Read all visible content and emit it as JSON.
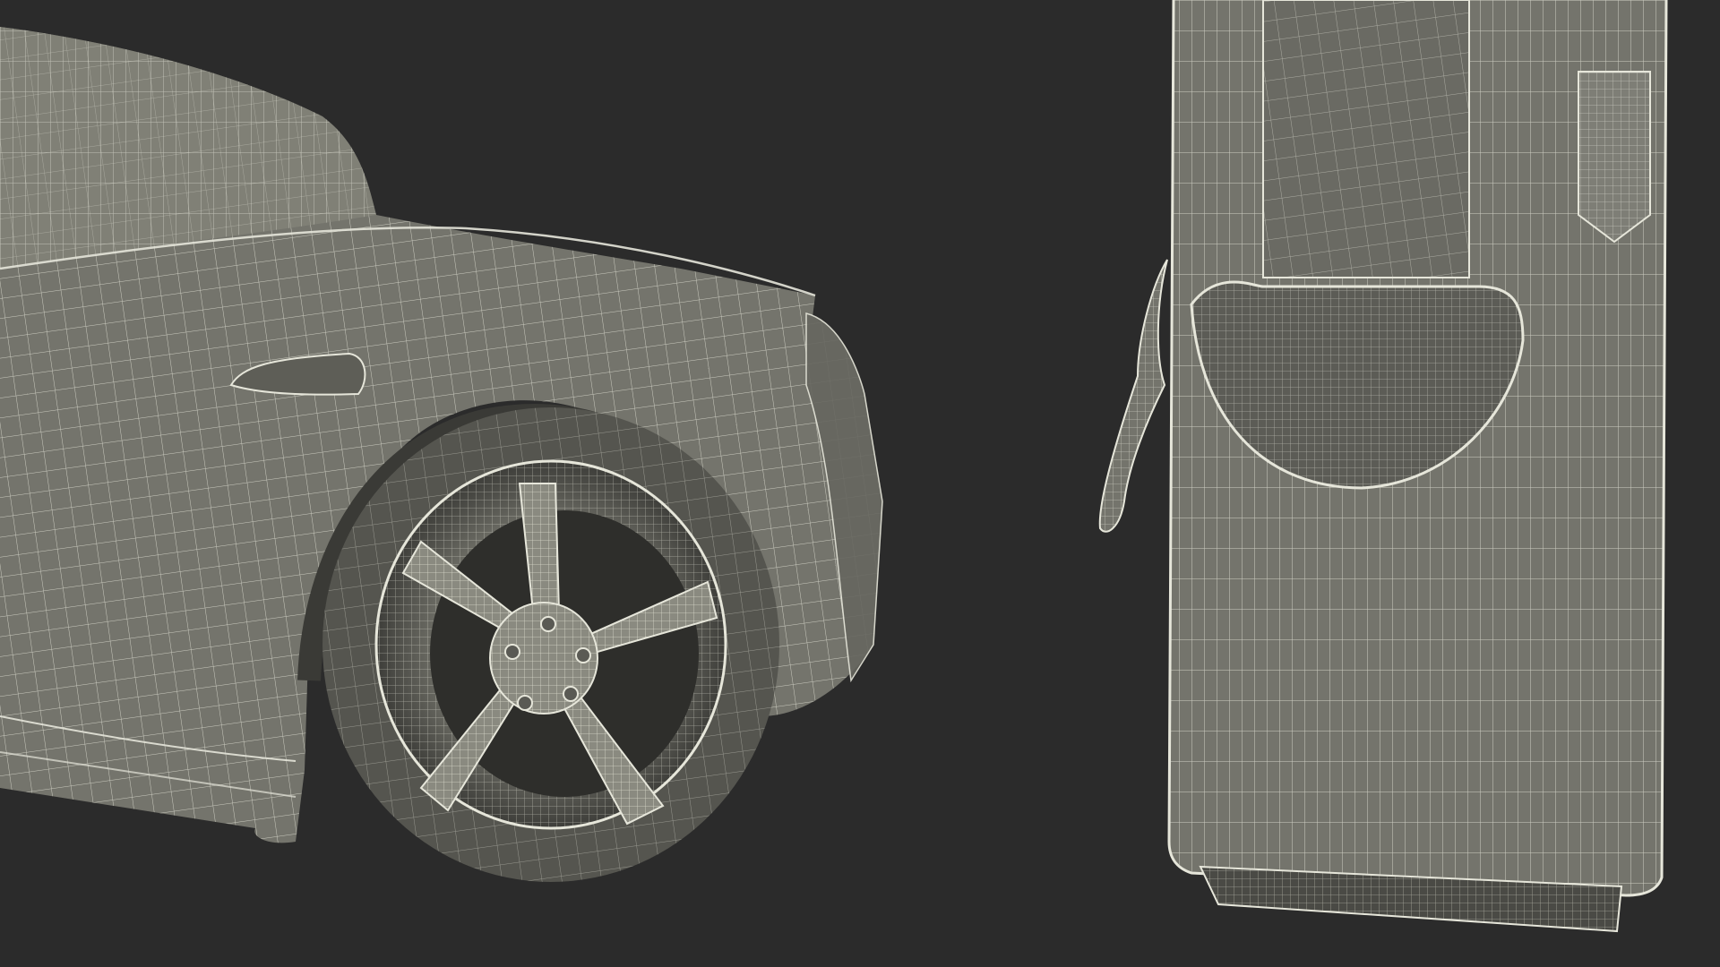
{
  "scene": {
    "background": "#2b2b2b",
    "mesh_fill": "#74746c",
    "mesh_fill_light": "#8a8a80",
    "mesh_shadow": "#4e4e48",
    "wire_color": "#e6e6da",
    "objects": [
      {
        "name": "car-body",
        "description_icon": "car-icon"
      },
      {
        "name": "front-wheel",
        "description_icon": "wheel-icon"
      },
      {
        "name": "charging-station",
        "description_icon": "ev-charger-icon"
      },
      {
        "name": "charging-cable",
        "description_icon": "cable-icon"
      }
    ]
  }
}
